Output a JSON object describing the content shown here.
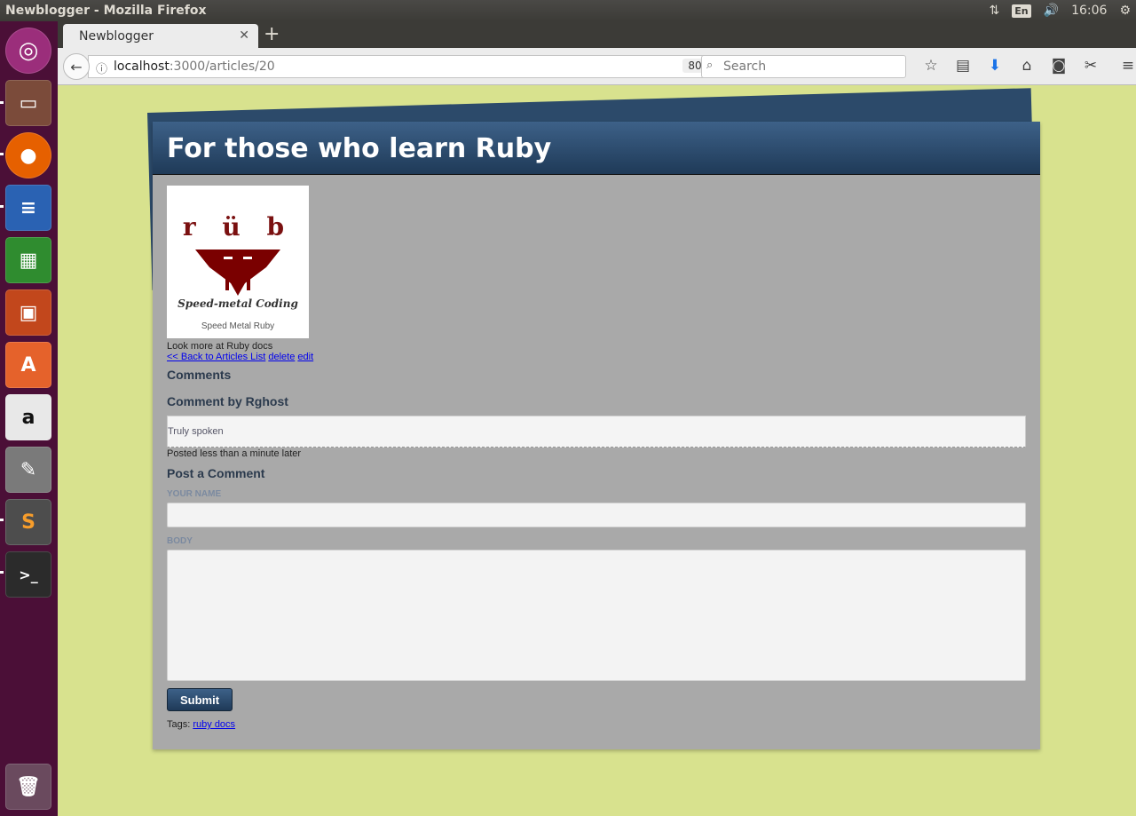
{
  "window": {
    "title": "Newblogger - Mozilla Firefox"
  },
  "tray": {
    "lang": "En",
    "time": "16:06"
  },
  "launcher": {
    "items": [
      "ubuntu-dash",
      "files",
      "firefox",
      "libreoffice-writer",
      "libreoffice-calc",
      "libreoffice-impress",
      "software-center",
      "amazon",
      "system-settings",
      "sublime-text",
      "terminal",
      "trash"
    ]
  },
  "browser": {
    "tab_title": "Newblogger",
    "url_host": "localhost",
    "url_path": ":3000/articles/20",
    "zoom": "80%",
    "search_placeholder": "Search"
  },
  "article": {
    "title": "For those who learn Ruby",
    "logo": {
      "top": "r ü b y",
      "middle": "Speed-metal Coding",
      "caption": "Speed Metal Ruby"
    },
    "body": "Look more at Ruby docs",
    "back_link": "<< Back to Articles List",
    "delete_link": "delete",
    "edit_link": "edit"
  },
  "comments": {
    "heading": "Comments",
    "items": [
      {
        "heading": "Comment by Rghost",
        "body": "Truly spoken",
        "posted": "Posted less than a minute later"
      }
    ]
  },
  "form": {
    "heading": "Post a Comment",
    "name_label": "YOUR NAME",
    "body_label": "BODY",
    "submit_label": "Submit"
  },
  "tags": {
    "label": "Tags:",
    "link": "ruby docs"
  },
  "colors": {
    "header_gradient_top": "#3d6188",
    "header_gradient_bottom": "#1f3a58",
    "page_bg": "#d8e28e",
    "card_bg": "#a9a9a9"
  }
}
